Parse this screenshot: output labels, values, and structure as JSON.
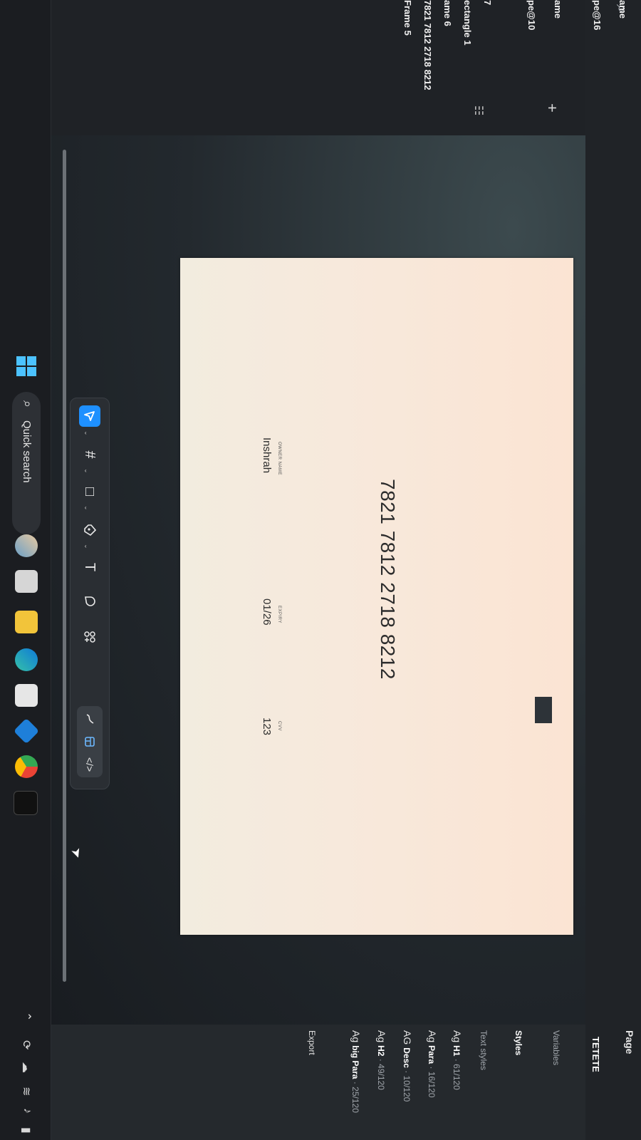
{
  "app": {
    "page_label": "Page",
    "page_name": "TETETE"
  },
  "layers": {
    "items": [
      "ame",
      "pe@16",
      "ame",
      "pe@10",
      "7",
      "ectangle 1",
      "ame 6",
      "7821 7812 2718 8212",
      "Frame 5"
    ]
  },
  "right_panel": {
    "tabs": {
      "variables": "Variables",
      "styles": "Styles"
    },
    "text_styles_heading": "Text styles",
    "ag": "Ag",
    "text_styles": [
      {
        "glyph": "Ag",
        "name": "H1",
        "meta": "· 61/120"
      },
      {
        "glyph": "Ag",
        "name": "Para",
        "meta": "· 16/120"
      },
      {
        "glyph": "AG",
        "name": "Desc",
        "meta": "· 10/120"
      },
      {
        "glyph": "Ag",
        "name": "H2",
        "meta": "· 49/120"
      },
      {
        "glyph": "Ag",
        "name": "big Para",
        "meta": "· 25/120"
      }
    ],
    "export_label": "Export"
  },
  "card": {
    "number": "7821 7812 2718 8212",
    "owner_label": "OWNER NAME",
    "owner_value": "Inshrah",
    "expiry_label": "EXPIRY",
    "expiry_value": "01/26",
    "cvv_label": "CVV",
    "cvv_value": "123",
    "colors": {
      "chip": "#2d3338",
      "background": "#f8e6d8"
    }
  },
  "toolbar": {
    "move_icon": "cursor-arrow-icon",
    "frame_icon": "#",
    "rect_icon": "□",
    "pen_icon": "pen-icon",
    "text_icon": "T",
    "comment_icon": "comment-icon",
    "actions_icon": "actions-icon",
    "draw_icon": "draw-icon",
    "dev_icon": "</>",
    "accent": "#1e90ff"
  },
  "taskbar": {
    "search_label": "Quick search"
  }
}
